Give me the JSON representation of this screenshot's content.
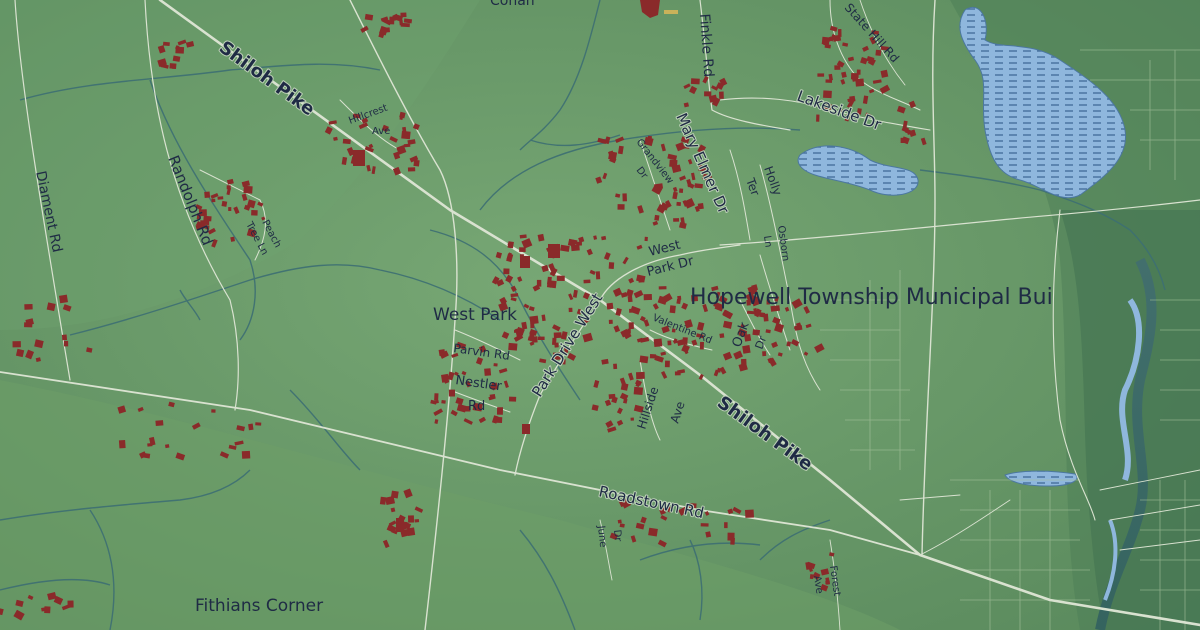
{
  "map": {
    "colors": {
      "land": "#6a9a67",
      "land_dark": "#4f7f57",
      "road": "#dbe3d2",
      "water": "#8fb7dd",
      "stream": "#3d6f73",
      "building": "#8a2a2a",
      "label": "#1f2b45"
    },
    "labels": {
      "shiloh_pike_1": "Shiloh Pike",
      "shiloh_pike_2": "Shiloh Pike",
      "diament_rd": "Diament Rd",
      "randolph_rd": "Randolph Rd",
      "peach_tree_ln_1": "Peach",
      "peach_tree_ln_2": "Tree Ln",
      "hillcrest_ave_1": "Hillcrest",
      "hillcrest_ave_2": "Ave",
      "west_park": "West Park",
      "parvin_rd": "Parvin Rd",
      "nestler_rd_1": "Nestler",
      "nestler_rd_2": "Rd",
      "park_drive_west": "Park Drive West",
      "hillside_ave_1": "Hillside",
      "hillside_ave_2": "Ave",
      "valentine_rd": "Valentine Rd",
      "oak_dr_1": "Oak",
      "oak_dr_2": "Dr",
      "west_park_dr_1": "West",
      "west_park_dr_2": "Park Dr",
      "grandview_dr_1": "Grandview",
      "grandview_dr_2": "Dr",
      "mary_elmer_dr": "Mary Elmer Dr",
      "holly_ter_1": "Holly",
      "holly_ter_2": "Ter",
      "osborn_ln_1": "Osborn",
      "osborn_ln_2": "Ln",
      "hopewell": "Hopewell Township Municipal Bui",
      "lakeside_dr": "Lakeside Dr",
      "state_hill_rd": "State Hill Rd",
      "finkle_rd": "Finkle Rd",
      "roadstown_rd": "Roadstown Rd",
      "june_dr_1": "June",
      "june_dr_2": "Dr",
      "forest_ave_1": "Forest",
      "forest_ave_2": "Ave",
      "fithians_corner": "Fithians Corner",
      "cohan_fragment": "Cohan"
    }
  }
}
